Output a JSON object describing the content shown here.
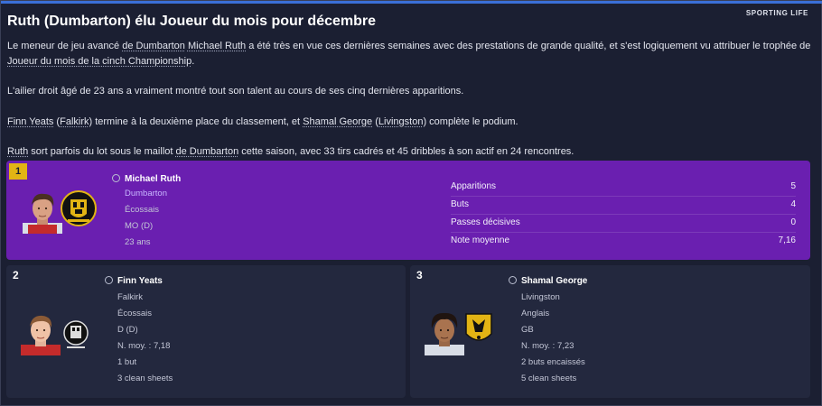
{
  "source": "SPORTING LIFE",
  "headline": "Ruth (Dumbarton) élu Joueur du mois pour décembre",
  "paragraphs": {
    "p1_a": "Le meneur de jeu avancé ",
    "p1_club": "de Dumbarton",
    "p1_space": " ",
    "p1_player": "Michael Ruth",
    "p1_b": " a été très en vue ces dernières semaines avec des prestations de grande qualité, et s'est logiquement vu attribuer le trophée de ",
    "p1_award": "Joueur du mois de la cinch Championship",
    "p1_end": ".",
    "p2": "L'ailier droit âgé de 23 ans a vraiment montré tout son talent au cours de ses cinq dernières apparitions.",
    "p3_player1": "Finn Yeats",
    "p3_open1": " (",
    "p3_club1": "Falkirk",
    "p3_mid": ") termine à la deuxième place du classement, et ",
    "p3_player2": "Shamal George",
    "p3_open2": " (",
    "p3_club2": "Livingston",
    "p3_end": ") complète le podium.",
    "p4_player": "Ruth",
    "p4_a": " sort parfois du lot sous le maillot ",
    "p4_club": "de Dumbarton",
    "p4_b": " cette saison, avec 33 tirs cadrés et 45 dribbles à son actif en 24 rencontres."
  },
  "first": {
    "rank": "1",
    "name": "Michael Ruth",
    "club": "Dumbarton",
    "nationality": "Écossais",
    "position": "MO (D)",
    "age": "23 ans",
    "stats": [
      {
        "label": "Apparitions",
        "value": "5"
      },
      {
        "label": "Buts",
        "value": "4"
      },
      {
        "label": "Passes décisives",
        "value": "0"
      },
      {
        "label": "Note moyenne",
        "value": "7,16"
      }
    ]
  },
  "second": {
    "rank": "2",
    "name": "Finn Yeats",
    "club": "Falkirk",
    "nationality": "Écossais",
    "position": "D (D)",
    "rating": "N. moy. : 7,18",
    "line5": "1 but",
    "line6": "3 clean sheets"
  },
  "third": {
    "rank": "3",
    "name": "Shamal George",
    "club": "Livingston",
    "nationality": "Anglais",
    "position": "GB",
    "rating": "N. moy. : 7,23",
    "line5": "2 buts encaissés",
    "line6": "5 clean sheets"
  },
  "colors": {
    "background": "#1b1f32",
    "first_card": "#6a1fb0",
    "rank_badge": "#e2b414",
    "card": "#23283e",
    "accent_bar": "#3a6fd8"
  },
  "icons": [
    "person-icon",
    "player-face",
    "club-crest"
  ]
}
